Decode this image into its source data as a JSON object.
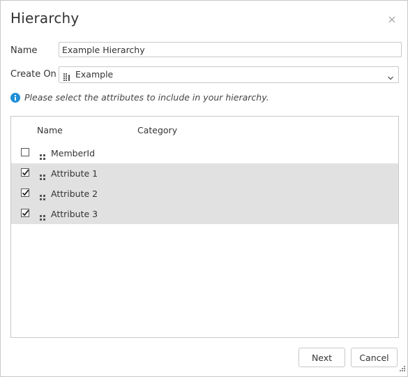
{
  "dialog": {
    "title": "Hierarchy"
  },
  "form": {
    "name_label": "Name",
    "name_value": "Example Hierarchy",
    "create_on_label": "Create On",
    "create_on_value": "Example"
  },
  "info": {
    "message": "Please select the attributes to include in your hierarchy."
  },
  "list": {
    "headers": {
      "name": "Name",
      "category": "Category"
    },
    "rows": [
      {
        "label": "MemberId",
        "checked": false,
        "category": ""
      },
      {
        "label": "Attribute 1",
        "checked": true,
        "category": ""
      },
      {
        "label": "Attribute 2",
        "checked": true,
        "category": ""
      },
      {
        "label": "Attribute 3",
        "checked": true,
        "category": ""
      }
    ]
  },
  "buttons": {
    "next": "Next",
    "cancel": "Cancel"
  },
  "icons": {
    "close": "close-icon",
    "info": "info-icon",
    "dimension": "grid-icon",
    "attribute": "attribute-dots-icon",
    "dropdown": "chevron-down-icon",
    "resize": "resize-grip-icon"
  },
  "colors": {
    "info_blue": "#1f8fd6",
    "selected_row": "#e1e1e1",
    "border": "#c8c8c8"
  }
}
